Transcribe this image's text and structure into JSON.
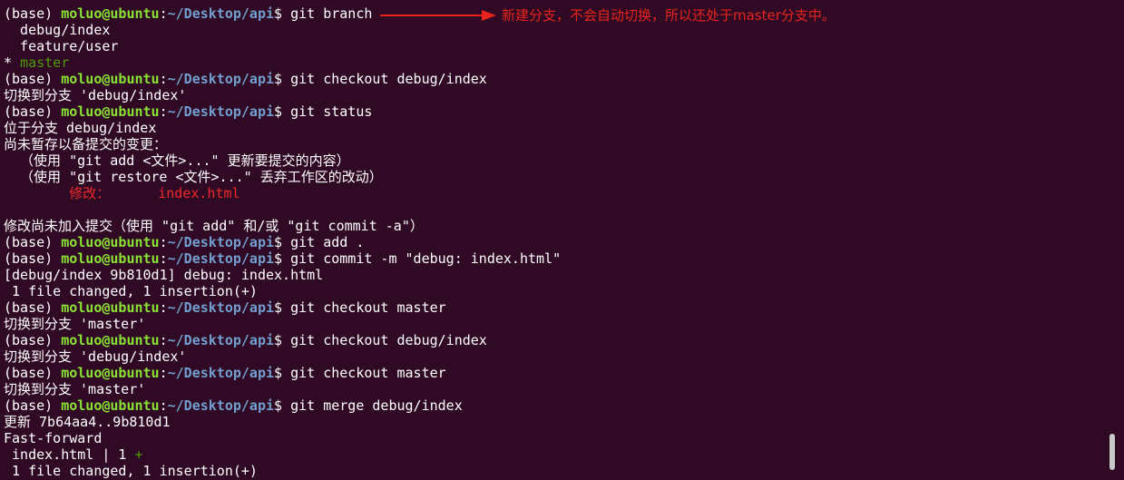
{
  "prompt": {
    "env": "(base) ",
    "user": "moluo@ubuntu",
    "colon": ":",
    "path": "~/Desktop/api",
    "dollar": "$ "
  },
  "lines": [
    {
      "type": "cmd",
      "text": "git branch"
    },
    {
      "type": "text",
      "text": "  debug/index"
    },
    {
      "type": "text",
      "text": "  feature/user"
    },
    {
      "type": "current",
      "star": "* ",
      "text": "master"
    },
    {
      "type": "cmd",
      "text": "git checkout debug/index"
    },
    {
      "type": "text",
      "text": "切换到分支 'debug/index'"
    },
    {
      "type": "cmd",
      "text": "git status"
    },
    {
      "type": "text",
      "text": "位于分支 debug/index"
    },
    {
      "type": "text",
      "text": "尚未暂存以备提交的变更："
    },
    {
      "type": "text",
      "text": "  （使用 \"git add <文件>...\" 更新要提交的内容）"
    },
    {
      "type": "text",
      "text": "  （使用 \"git restore <文件>...\" 丢弃工作区的改动）"
    },
    {
      "type": "modified",
      "label": "修改：",
      "text": "index.html"
    },
    {
      "type": "text",
      "text": ""
    },
    {
      "type": "text",
      "text": "修改尚未加入提交（使用 \"git add\" 和/或 \"git commit -a\"）"
    },
    {
      "type": "cmd",
      "text": "git add ."
    },
    {
      "type": "cmd",
      "text": "git commit -m \"debug: index.html\""
    },
    {
      "type": "text",
      "text": "[debug/index 9b810d1] debug: index.html"
    },
    {
      "type": "text",
      "text": " 1 file changed, 1 insertion(+)"
    },
    {
      "type": "cmd",
      "text": "git checkout master"
    },
    {
      "type": "text",
      "text": "切换到分支 'master'"
    },
    {
      "type": "cmd",
      "text": "git checkout debug/index"
    },
    {
      "type": "text",
      "text": "切换到分支 'debug/index'"
    },
    {
      "type": "cmd",
      "text": "git checkout master"
    },
    {
      "type": "text",
      "text": "切换到分支 'master'"
    },
    {
      "type": "cmd",
      "text": "git merge debug/index"
    },
    {
      "type": "text",
      "text": "更新 7b64aa4..9b810d1"
    },
    {
      "type": "text",
      "text": "Fast-forward"
    },
    {
      "type": "diffstat",
      "text": " index.html | 1 ",
      "plus": "+"
    },
    {
      "type": "text",
      "text": " 1 file changed, 1 insertion(+)"
    }
  ],
  "annotation": {
    "text": "新建分支，不会自动切换，所以还处于master分支中。",
    "color": "#e8241d"
  },
  "colors": {
    "background": "#300a24",
    "prompt_user": "#8ae234",
    "prompt_path": "#729fcf",
    "current_branch": "#4e9a06",
    "modified": "#ef2929"
  }
}
